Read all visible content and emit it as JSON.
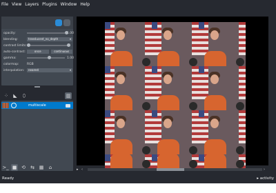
{
  "menu": [
    "File",
    "View",
    "Layers",
    "Plugins",
    "Window",
    "Help"
  ],
  "controls": {
    "opacity_label": "opacity:",
    "opacity_value": "1.00",
    "blending_label": "blending:",
    "blending_value": "translucent_no_depth",
    "contrast_label": "contrast limits:",
    "auto_contrast_label": "auto-contrast:",
    "auto_once": "once",
    "auto_continuous": "continuous",
    "gamma_label": "gamma:",
    "gamma_value": "1.00",
    "colormap_label": "colormap:",
    "colormap_value": "RGB",
    "interpolation_label": "interpolation:",
    "interpolation_value": "nearest"
  },
  "layers": [
    {
      "name": "multiscale"
    }
  ],
  "status": {
    "left": "Ready",
    "right": "▸ activity"
  },
  "colors": {
    "background": "#262930",
    "panel": "#414851",
    "accent": "#007acc",
    "canvas": "#000000"
  },
  "icons": [
    "points-icon",
    "shapes-icon",
    "labels-icon",
    "delete-icon",
    "console-icon",
    "ndisplay-icon",
    "roll-icon",
    "transpose-icon",
    "grid-icon",
    "home-icon"
  ]
}
